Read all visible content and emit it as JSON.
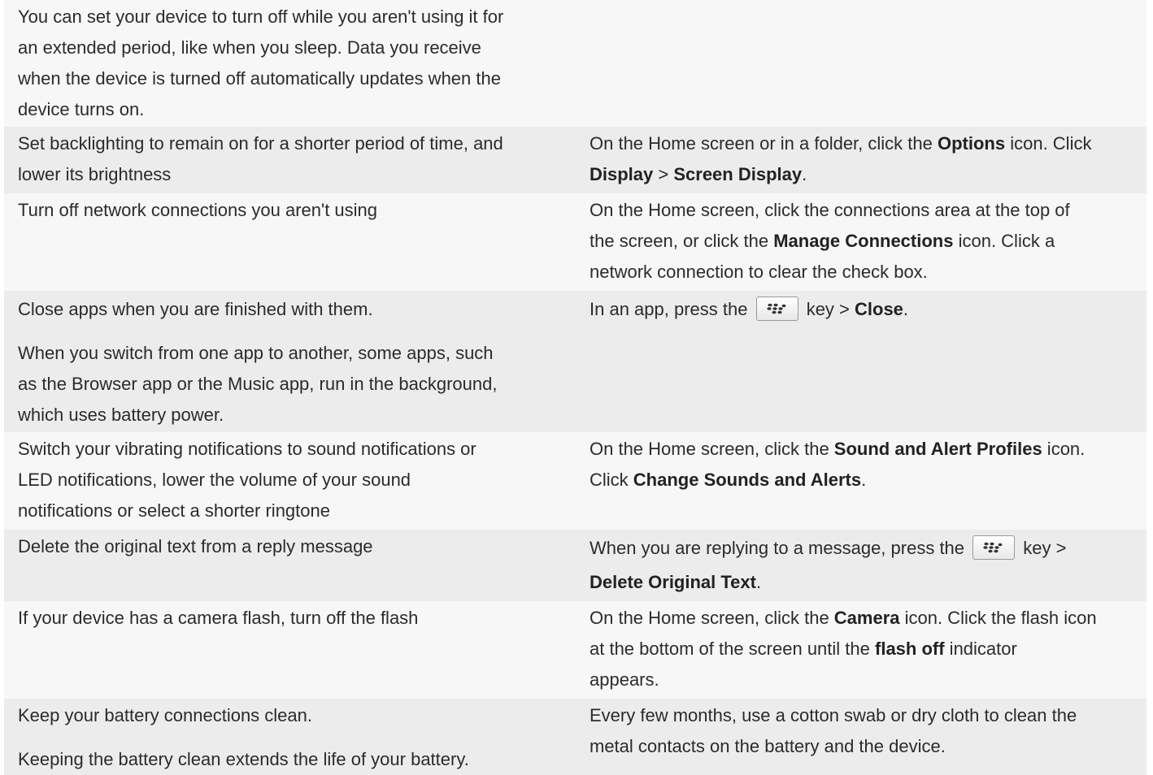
{
  "rows": [
    {
      "tip": [
        "You can set your device to turn off while you aren't using it for",
        "an extended period, like when you sleep. Data you receive",
        "when the device is turned off automatically updates when the",
        "device turns on."
      ]
    },
    {
      "tip": [
        "Set backlighting to remain on for a shorter period of time, and",
        "lower its brightness"
      ],
      "how": {
        "l1": "On the Home screen or in a folder, click the ",
        "b1": "Options",
        "l2": " icon. Click",
        "b2": "Display",
        "sep": " > ",
        "b3": "Screen Display",
        "end": "."
      }
    },
    {
      "tip": [
        "Turn off network connections you aren't using"
      ],
      "how": {
        "l1": "On the Home screen, click the connections area at the top of",
        "l2a": "the screen, or click the ",
        "b1": "Manage Connections",
        "l2b": " icon. Click a",
        "l3": "network connection to clear the check box."
      }
    },
    {
      "tip": [
        "Close apps when you are finished with them."
      ],
      "tip2": [
        "When you switch from one app to another, some apps, such",
        "as the Browser app or the Music app, run in the background,",
        "which uses battery power."
      ],
      "how": {
        "a": "In an app, press the ",
        "b": " key > ",
        "b1": "Close",
        "end": "."
      }
    },
    {
      "tip": [
        "Switch your vibrating notifications to sound notifications or",
        "LED notifications, lower the volume of your sound",
        "notifications or select a shorter ringtone"
      ],
      "how": {
        "l1": "On the Home screen, click the ",
        "b1": "Sound and Alert Profiles",
        "l1b": " icon.",
        "l2": "Click ",
        "b2": "Change Sounds and Alerts",
        "end": "."
      }
    },
    {
      "tip": [
        "Delete the original text from a reply message"
      ],
      "how": {
        "a": "When you are replying to a message, press the ",
        "b": " key >",
        "b1": "Delete Original Text",
        "end": "."
      }
    },
    {
      "tip": [
        "If your device has a camera flash, turn off the flash"
      ],
      "how": {
        "l1": "On the Home screen, click the ",
        "b1": "Camera",
        "l1b": " icon. Click the flash icon",
        "l2": "at the bottom of the screen until the ",
        "b2": "flash off",
        "l2b": " indicator",
        "l3": "appears."
      }
    },
    {
      "tip": [
        "Keep your battery connections clean."
      ],
      "tip2": [
        "Keeping the battery clean extends the life of your battery."
      ],
      "how": {
        "l1": "Every few months, use a cotton swab or dry cloth to clean the",
        "l2": "metal contacts on the battery and the device."
      }
    }
  ],
  "icons": {
    "menu_key": "blackberry-menu-key-icon"
  },
  "colors": {
    "row_shaded": "#ececec",
    "row_plain": "#f7f7f7",
    "text": "#2b2b2b"
  }
}
